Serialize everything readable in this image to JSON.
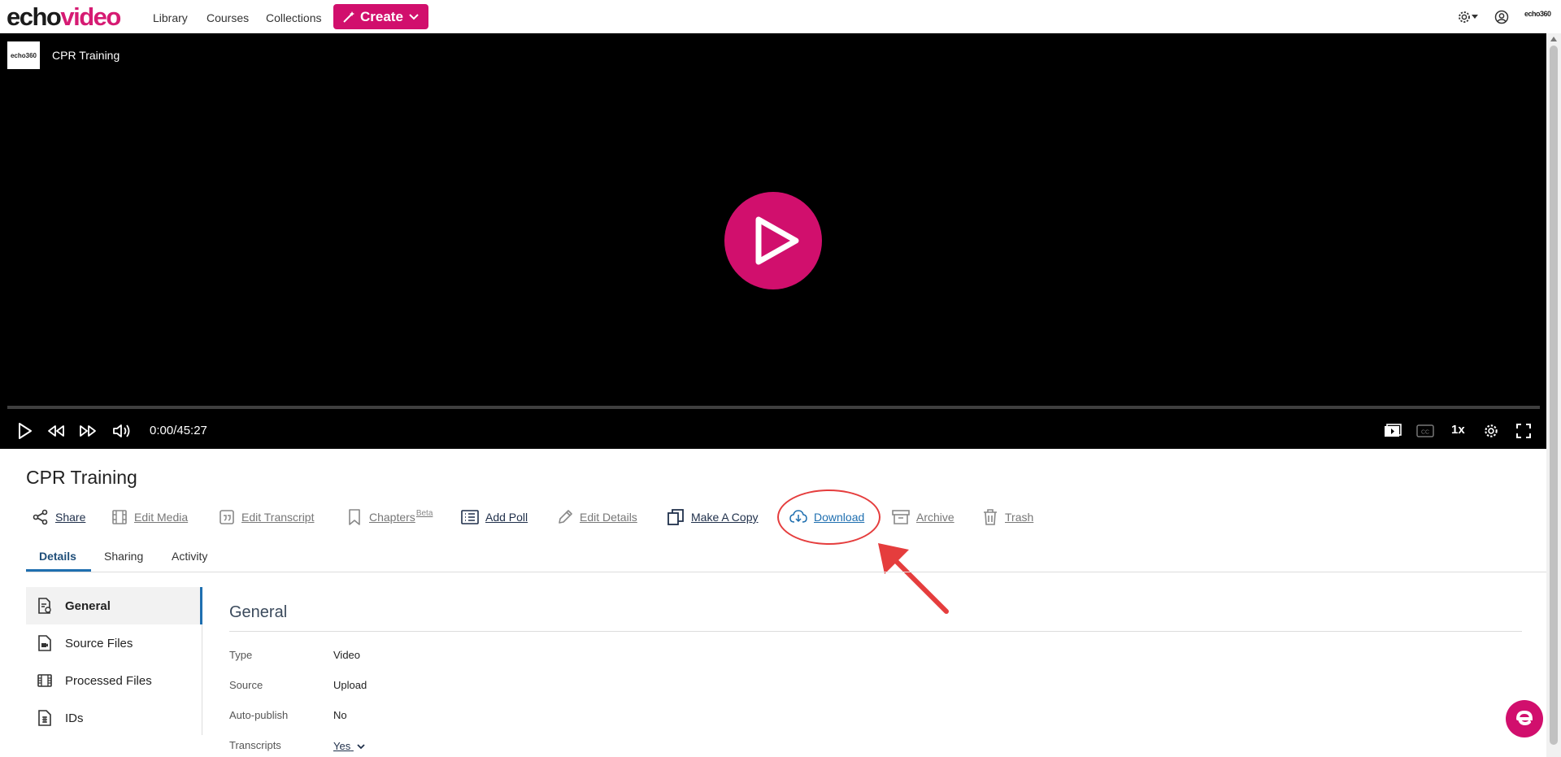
{
  "app": {
    "logo_part1": "echo",
    "logo_part2": "video",
    "nav": [
      "Library",
      "Courses",
      "Collections"
    ],
    "create_label": "Create",
    "brand_small": "echo360"
  },
  "player": {
    "logo_text": "echo360",
    "title": "CPR Training",
    "time": "0:00/45:27",
    "speed": "1x"
  },
  "media": {
    "title": "CPR Training",
    "actions": [
      {
        "label": "Share",
        "icon": "share-icon"
      },
      {
        "label": "Edit Media",
        "icon": "film-icon"
      },
      {
        "label": "Edit Transcript",
        "icon": "quote-icon"
      },
      {
        "label": "Chapters",
        "sup": "Beta",
        "icon": "bookmark-icon"
      },
      {
        "label": "Add Poll",
        "icon": "list-icon"
      },
      {
        "label": "Edit Details",
        "icon": "pencil-icon"
      },
      {
        "label": "Make A Copy",
        "icon": "copy-icon"
      },
      {
        "label": "Download",
        "icon": "cloud-download-icon"
      },
      {
        "label": "Archive",
        "icon": "archive-icon"
      },
      {
        "label": "Trash",
        "icon": "trash-icon"
      }
    ]
  },
  "tabs": [
    "Details",
    "Sharing",
    "Activity"
  ],
  "sidebar": [
    {
      "label": "General",
      "icon": "general-doc-icon"
    },
    {
      "label": "Source Files",
      "icon": "source-file-icon"
    },
    {
      "label": "Processed Files",
      "icon": "processed-film-icon"
    },
    {
      "label": "IDs",
      "icon": "ids-icon"
    }
  ],
  "general": {
    "heading": "General",
    "fields": [
      {
        "label": "Type",
        "value": "Video"
      },
      {
        "label": "Source",
        "value": "Upload"
      },
      {
        "label": "Auto-publish",
        "value": "No"
      },
      {
        "label": "Transcripts",
        "value": "Yes"
      }
    ]
  },
  "colors": {
    "brand_pink": "#d10f6d",
    "highlight_red": "#e53d3d",
    "link_blue": "#1f6fb0"
  }
}
